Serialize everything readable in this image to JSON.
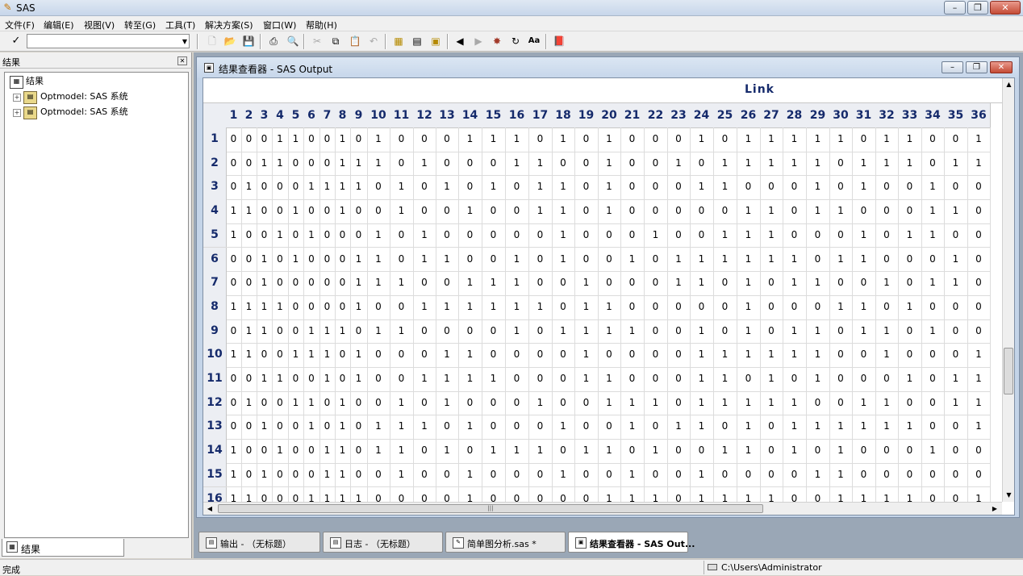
{
  "app": {
    "title": "SAS",
    "window_buttons": {
      "minimize": "–",
      "restore": "❐",
      "close": "✕"
    }
  },
  "menu": [
    "文件(F)",
    "编辑(E)",
    "视图(V)",
    "转至(G)",
    "工具(T)",
    "解决方案(S)",
    "窗口(W)",
    "帮助(H)"
  ],
  "toolbar": {
    "check_glyph": "✓",
    "command_value": "",
    "combo_arrow": "▼",
    "icons": [
      "new-icon",
      "open-icon",
      "save-icon",
      "print-icon",
      "print-preview-icon",
      "cut-icon",
      "copy-icon",
      "paste-icon",
      "undo-icon",
      "library-icon",
      "explorer-icon",
      "results-icon",
      "back-icon",
      "forward-icon",
      "submit-icon",
      "refresh-icon",
      "font-icon",
      "help-book-icon"
    ]
  },
  "results_panel": {
    "header": "结果",
    "close_glyph": "✕",
    "tree_root": "结果",
    "tree_items": [
      "Optmodel:  SAS 系统",
      "Optmodel:  SAS 系统"
    ],
    "tab_label": "结果"
  },
  "viewer": {
    "title": "结果查看器 - SAS Output",
    "table_title": "Link",
    "columns": [
      "1",
      "2",
      "3",
      "4",
      "5",
      "6",
      "7",
      "8",
      "9",
      "10",
      "11",
      "12",
      "13",
      "14",
      "15",
      "16",
      "17",
      "18",
      "19",
      "20",
      "21",
      "22",
      "23",
      "24",
      "25",
      "26",
      "27",
      "28",
      "29",
      "30",
      "31",
      "32",
      "33",
      "34",
      "35",
      "36"
    ],
    "rows": [
      {
        "label": "1",
        "values": [
          0,
          0,
          0,
          1,
          1,
          0,
          0,
          1,
          0,
          1,
          0,
          0,
          0,
          1,
          1,
          1,
          0,
          1,
          0,
          1,
          0,
          0,
          0,
          1,
          0,
          1,
          1,
          1,
          1,
          1,
          0,
          1,
          1,
          0,
          0,
          1
        ]
      },
      {
        "label": "2",
        "values": [
          0,
          0,
          1,
          1,
          0,
          0,
          0,
          1,
          1,
          1,
          0,
          1,
          0,
          0,
          0,
          1,
          1,
          0,
          0,
          1,
          0,
          0,
          1,
          0,
          1,
          1,
          1,
          1,
          1,
          0,
          1,
          1,
          1,
          0,
          1,
          1
        ]
      },
      {
        "label": "3",
        "values": [
          0,
          1,
          0,
          0,
          0,
          1,
          1,
          1,
          1,
          0,
          1,
          0,
          1,
          0,
          1,
          0,
          1,
          1,
          0,
          1,
          0,
          0,
          0,
          1,
          1,
          0,
          0,
          0,
          1,
          0,
          1,
          0,
          0,
          1,
          0,
          0
        ]
      },
      {
        "label": "4",
        "values": [
          1,
          1,
          0,
          0,
          1,
          0,
          0,
          1,
          0,
          0,
          1,
          0,
          0,
          1,
          0,
          0,
          1,
          1,
          0,
          1,
          0,
          0,
          0,
          0,
          0,
          1,
          1,
          0,
          1,
          1,
          0,
          0,
          0,
          1,
          1,
          0
        ]
      },
      {
        "label": "5",
        "values": [
          1,
          0,
          0,
          1,
          0,
          1,
          0,
          0,
          0,
          1,
          0,
          1,
          0,
          0,
          0,
          0,
          0,
          1,
          0,
          0,
          0,
          1,
          0,
          0,
          1,
          1,
          1,
          0,
          0,
          0,
          1,
          0,
          1,
          1,
          0,
          0
        ]
      },
      {
        "label": "6",
        "values": [
          0,
          0,
          1,
          0,
          1,
          0,
          0,
          0,
          1,
          1,
          0,
          1,
          1,
          0,
          0,
          1,
          0,
          1,
          0,
          0,
          1,
          0,
          1,
          1,
          1,
          1,
          1,
          1,
          0,
          1,
          1,
          0,
          0,
          0,
          1,
          0
        ]
      },
      {
        "label": "7",
        "values": [
          0,
          0,
          1,
          0,
          0,
          0,
          0,
          0,
          1,
          1,
          1,
          0,
          0,
          1,
          1,
          1,
          0,
          0,
          1,
          0,
          0,
          0,
          1,
          1,
          0,
          1,
          0,
          1,
          1,
          0,
          0,
          1,
          0,
          1,
          1,
          0
        ]
      },
      {
        "label": "8",
        "values": [
          1,
          1,
          1,
          1,
          0,
          0,
          0,
          0,
          1,
          0,
          0,
          1,
          1,
          1,
          1,
          1,
          1,
          0,
          1,
          1,
          0,
          0,
          0,
          0,
          0,
          1,
          0,
          0,
          0,
          1,
          1,
          0,
          1,
          0,
          0,
          0
        ]
      },
      {
        "label": "9",
        "values": [
          0,
          1,
          1,
          0,
          0,
          1,
          1,
          1,
          0,
          1,
          1,
          0,
          0,
          0,
          0,
          1,
          0,
          1,
          1,
          1,
          1,
          0,
          0,
          1,
          0,
          1,
          0,
          1,
          1,
          0,
          1,
          1,
          0,
          1,
          0,
          0
        ]
      },
      {
        "label": "10",
        "values": [
          1,
          1,
          0,
          0,
          1,
          1,
          1,
          0,
          1,
          0,
          0,
          0,
          1,
          1,
          0,
          0,
          0,
          0,
          1,
          0,
          0,
          0,
          0,
          1,
          1,
          1,
          1,
          1,
          1,
          0,
          0,
          1,
          0,
          0,
          0,
          1
        ]
      },
      {
        "label": "11",
        "values": [
          0,
          0,
          1,
          1,
          0,
          0,
          1,
          0,
          1,
          0,
          0,
          1,
          1,
          1,
          1,
          0,
          0,
          0,
          1,
          1,
          0,
          0,
          0,
          1,
          1,
          0,
          1,
          0,
          1,
          0,
          0,
          0,
          1,
          0,
          1,
          1
        ]
      },
      {
        "label": "12",
        "values": [
          0,
          1,
          0,
          0,
          1,
          1,
          0,
          1,
          0,
          0,
          1,
          0,
          1,
          0,
          0,
          0,
          1,
          0,
          0,
          1,
          1,
          1,
          0,
          1,
          1,
          1,
          1,
          1,
          0,
          0,
          1,
          1,
          0,
          0,
          1,
          1
        ]
      },
      {
        "label": "13",
        "values": [
          0,
          0,
          1,
          0,
          0,
          1,
          0,
          1,
          0,
          1,
          1,
          1,
          0,
          1,
          0,
          0,
          0,
          1,
          0,
          0,
          1,
          0,
          1,
          1,
          0,
          1,
          0,
          1,
          1,
          1,
          1,
          1,
          1,
          0,
          0,
          1
        ]
      },
      {
        "label": "14",
        "values": [
          1,
          0,
          0,
          1,
          0,
          0,
          1,
          1,
          0,
          1,
          1,
          0,
          1,
          0,
          1,
          1,
          1,
          0,
          1,
          1,
          0,
          1,
          0,
          0,
          1,
          1,
          0,
          1,
          0,
          1,
          0,
          0,
          0,
          1,
          0,
          0
        ]
      },
      {
        "label": "15",
        "values": [
          1,
          0,
          1,
          0,
          0,
          0,
          1,
          1,
          0,
          0,
          1,
          0,
          0,
          1,
          0,
          0,
          0,
          1,
          0,
          0,
          1,
          0,
          0,
          1,
          0,
          0,
          0,
          0,
          1,
          1,
          0,
          0,
          0,
          0,
          0,
          0
        ]
      },
      {
        "label": "16",
        "values": [
          1,
          1,
          0,
          0,
          0,
          1,
          1,
          1,
          1,
          0,
          0,
          0,
          0,
          1,
          0,
          0,
          0,
          0,
          0,
          1,
          1,
          1,
          0,
          1,
          1,
          1,
          1,
          0,
          0,
          1,
          1,
          1,
          1,
          0,
          0,
          1
        ]
      }
    ],
    "scroll_grip": "|||",
    "arrows": {
      "up": "▲",
      "down": "▼",
      "left": "◀",
      "right": "▶"
    }
  },
  "window_tabs": [
    {
      "label": "输出 - （无标题）",
      "active": false
    },
    {
      "label": "日志 - （无标题）",
      "active": false
    },
    {
      "label": "简单图分析.sas *",
      "active": false
    },
    {
      "label": "结果查看器 - SAS Out...",
      "active": true
    }
  ],
  "status": {
    "text": "完成",
    "path": "C:\\Users\\Administrator"
  }
}
